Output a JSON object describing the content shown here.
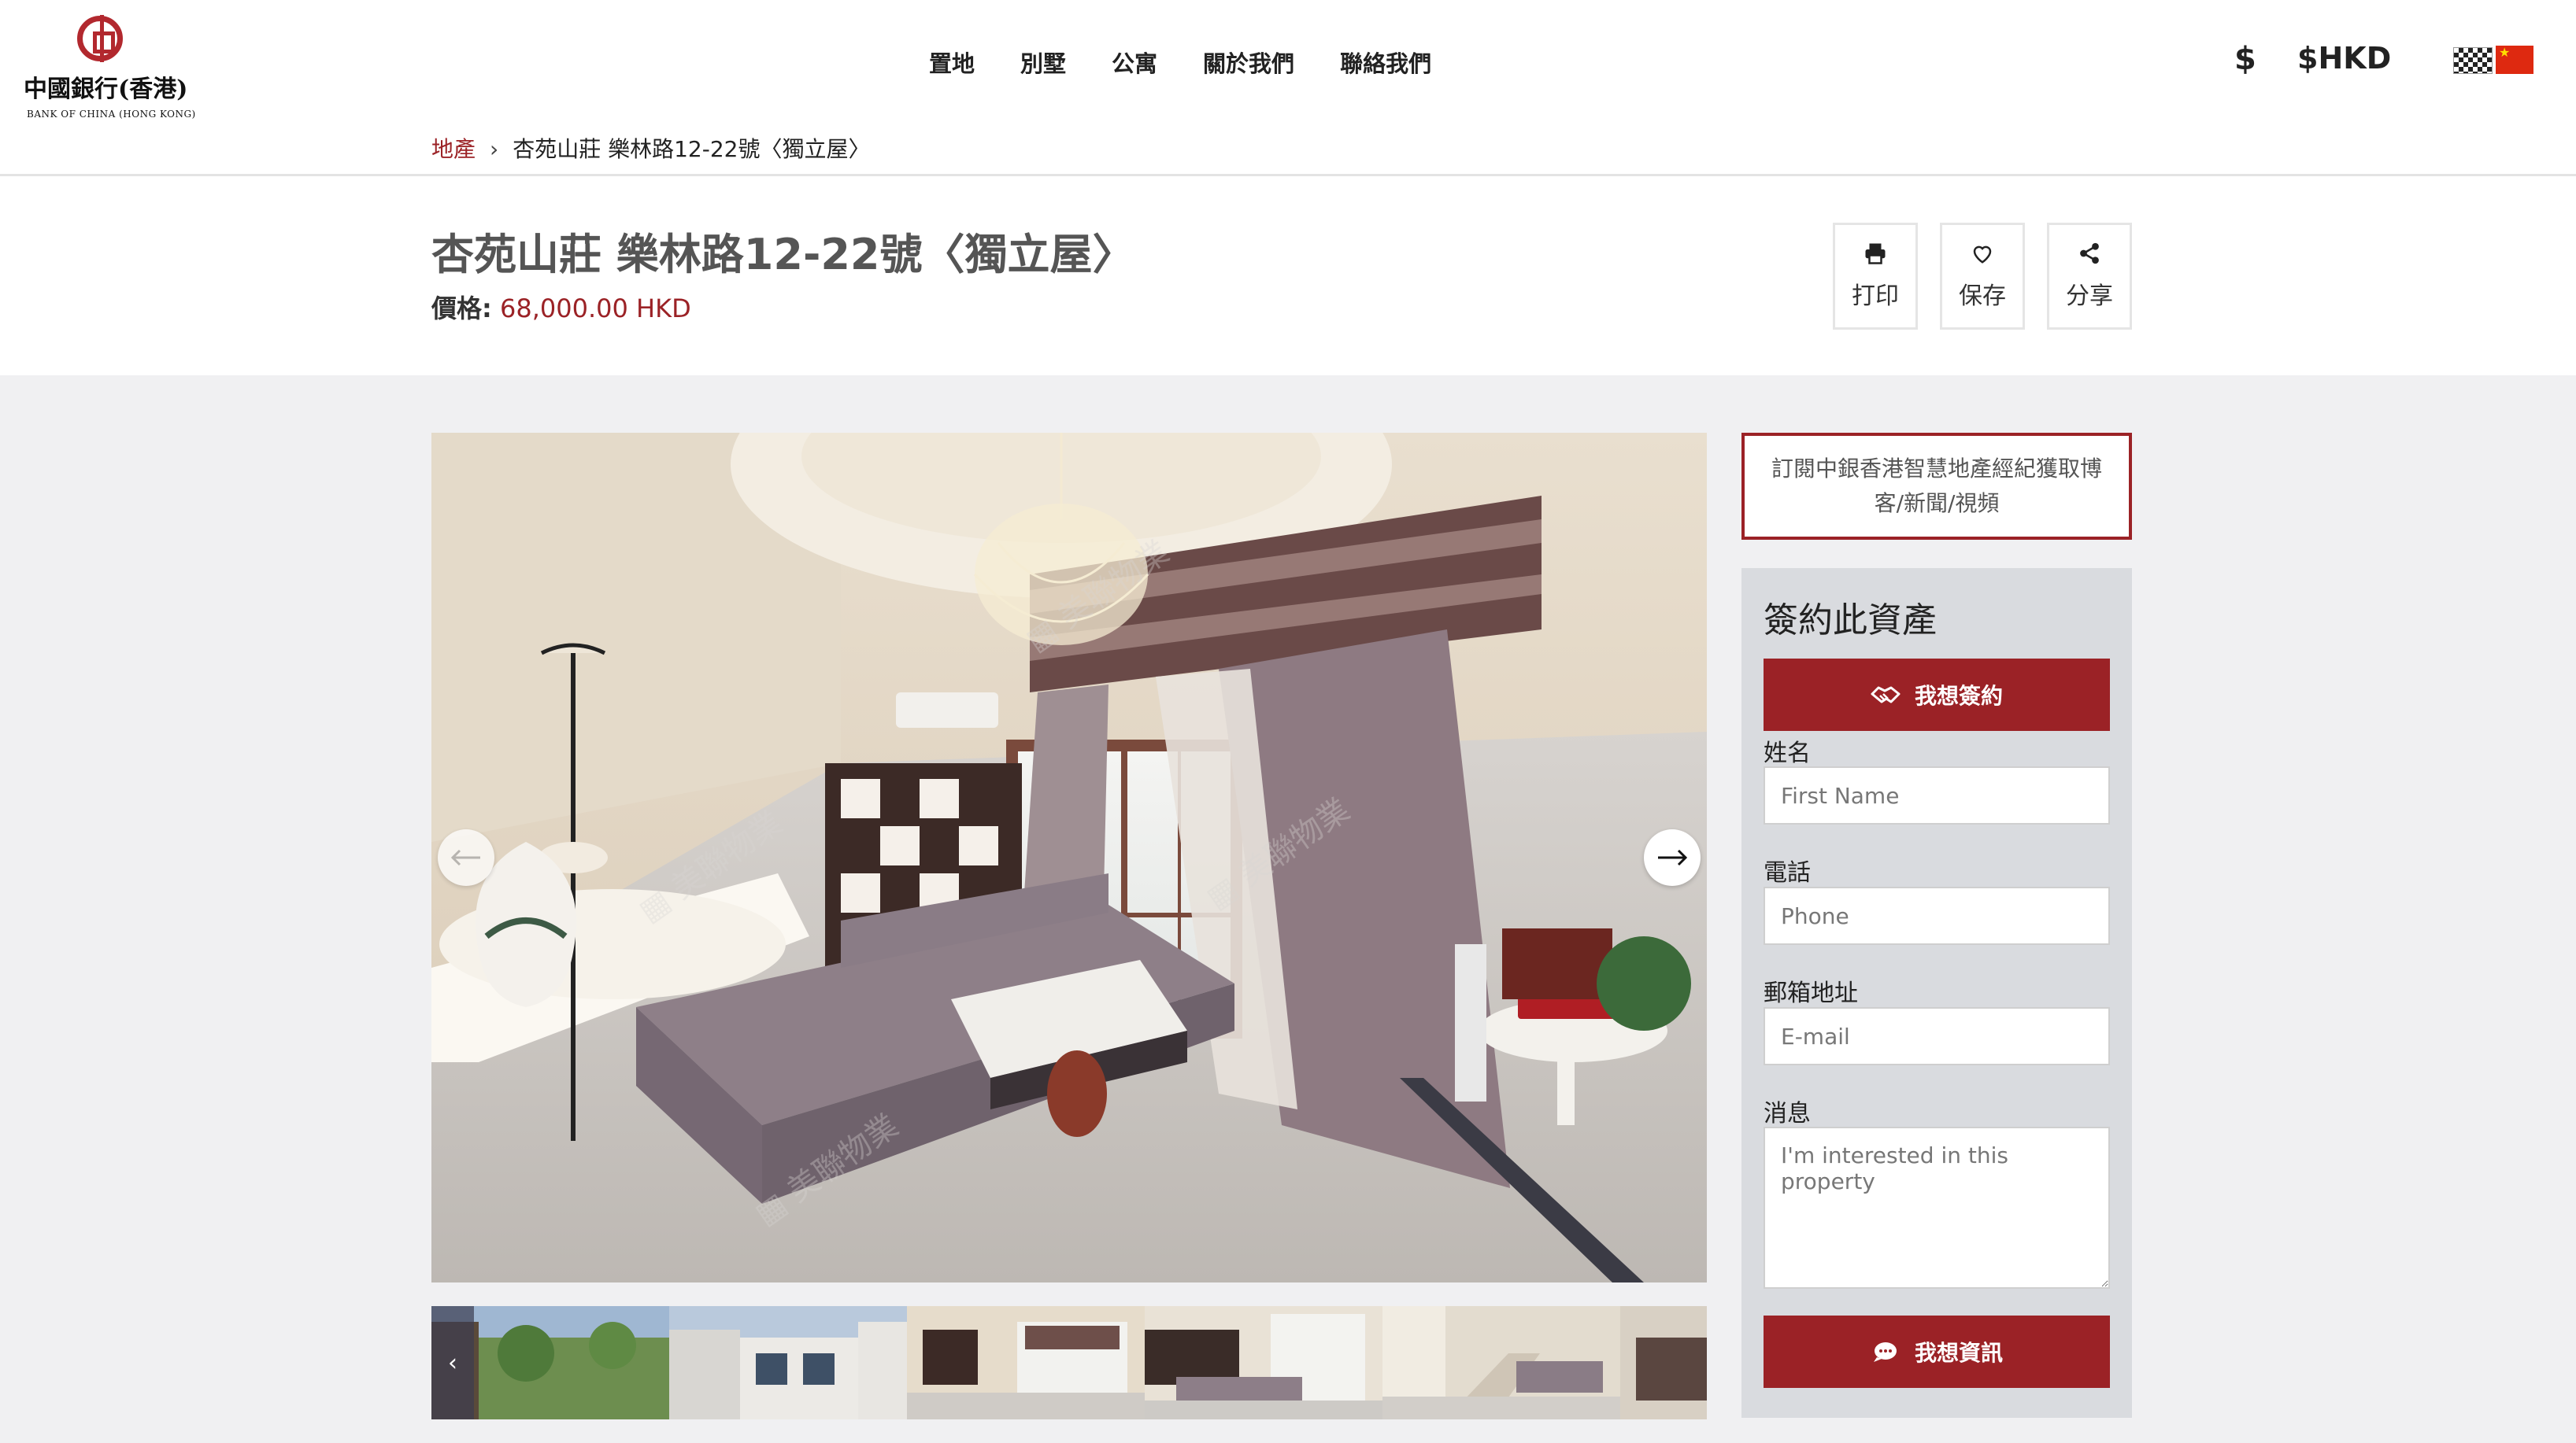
{
  "brand": {
    "name_cn": "中國銀行(香港)",
    "name_en": "BANK OF CHINA (HONG KONG)"
  },
  "nav": {
    "items": [
      "置地",
      "別墅",
      "公寓",
      "關於我們",
      "聯絡我們"
    ]
  },
  "currency": {
    "symbol": "$",
    "label": "$HKD"
  },
  "breadcrumb": {
    "parent": "地產",
    "current": "杏苑山莊 樂林路12-22號〈獨立屋〉"
  },
  "listing": {
    "title": "杏苑山莊 樂林路12-22號〈獨立屋〉",
    "price_label": "價格:",
    "price_value": "68,000.00 HKD"
  },
  "actions": {
    "print": "打印",
    "save": "保存",
    "share": "分享"
  },
  "sidebar": {
    "subscribe_text": "訂閱中銀香港智慧地產經紀獲取博客/新聞/視頻",
    "contact_title": "簽約此資產",
    "sign_button": "我想簽約",
    "info_button": "我想資訊",
    "fields": {
      "name_label": "姓名",
      "name_placeholder": "First Name",
      "phone_label": "電話",
      "phone_placeholder": "Phone",
      "email_label": "郵箱地址",
      "email_placeholder": "E-mail",
      "message_label": "消息",
      "message_placeholder": "I'm interested in this property"
    }
  },
  "colors": {
    "accent": "#9b2226",
    "sidebar_bg": "#d9dbdf",
    "content_bg": "#f0f0f2"
  },
  "icons": [
    "print-icon",
    "heart-icon",
    "share-icon",
    "handshake-icon",
    "chat-icon",
    "arrow-left-icon",
    "arrow-right-icon",
    "chevron-left-icon"
  ]
}
